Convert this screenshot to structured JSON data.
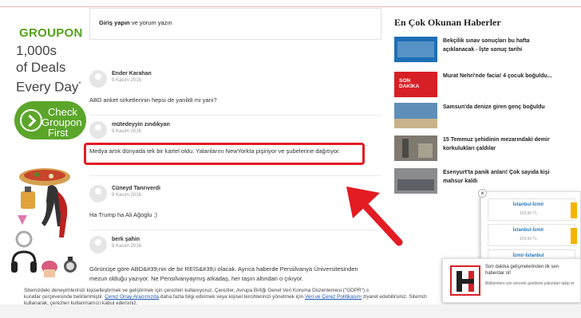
{
  "ad": {
    "logo": "GROUPON",
    "line1": "1,000s",
    "line2": "of Deals",
    "line3": "Every Day",
    "line3_mark": "*",
    "button_line1": "Check",
    "button_line2": "Groupon",
    "button_line3": "First"
  },
  "login": {
    "link": "Giriş yapın",
    "rest": " ve yorum yazın"
  },
  "comments": [
    {
      "name": "Ender Karahan",
      "date": "9 Kasım 2016",
      "text": "ABD anket sirketlerinin hepsi de yanildi mi yani?"
    },
    {
      "name": "mütedeyyin zındıkyan",
      "date": "9 Kasım 2016",
      "text": "Medya artık dünyada tek bir kartel oldu. Yalanlarını NewYorkta pişiriyor ve şubelerine dağıtıyor."
    },
    {
      "name": "Cüneyd Tanrıverdi",
      "date": "9 Kasım 2016",
      "text": "Ha Trump ha Ali Ağoglu :)"
    },
    {
      "name": "berk şahin",
      "date": "9 Kasım 2016",
      "text": "Görünüşe göre ABD&#39;nin de bir REİS&#39;i olacak. Ayrıca haberde Pensilvanya Üniversitesinden",
      "text2": "mezun olduğu yazıyor. Ne Pensilvanyaymış arkadaş, her taşın altından o çıkıyor."
    }
  ],
  "sidebar": {
    "title": "En Çok Okunan Haberler",
    "items": [
      {
        "title": "Bekçilik sınav sonuçları bu hafta açıklanacak - İşte sonuç tarihi",
        "thumb_color": "#1f6fb5"
      },
      {
        "title": "Murat Nehri'nde facia! 4 çocuk boğuldu...",
        "thumb_color": "#d71f26",
        "thumb_text": "SON DAKİKA"
      },
      {
        "title": "Samsun'da denize giren genç boğuldu",
        "thumb_color": "#5f8fb8"
      },
      {
        "title": "15 Temmuz şehidinin mezarındaki demir korkulukları çaldılar",
        "thumb_color": "#7f7a70"
      },
      {
        "title": "Esenyurt'ta panik anları! Çok sayıda kişi mahsur kaldı",
        "thumb_color": "#8a8c8f"
      }
    ]
  },
  "ticket": {
    "routes": [
      {
        "name": "İstanbul-İzmir",
        "price": "109,99 TL"
      },
      {
        "name": "İstanbul-İzmir",
        "price": "109,99 TL"
      },
      {
        "name": "İzmir-İstanbul",
        "price": ""
      }
    ]
  },
  "notification": {
    "title": "Son dakika gelişmelerinden ilk sen haberdar ol!",
    "subtitle": "Bildirimlere izin vererek gündemi yakından takip et"
  },
  "cookie": {
    "line1_a": "Sitemizdeki deneyimlerinizi kişiselleştirmek ve geliştirmek için çerezleri kullanıyoruz. Çerezler, Avrupa Birliği Genel Veri Koruma Düzenlemesi (\"GDPR\") s",
    "line2_a": "kurallar çerçevesinde belirlenmiştir. ",
    "link1": "Çerez Onay Aracımızda",
    "line2_b": " daha fazla bilgi edinmek veya kişisel tercihlerinizi yönetmek için ",
    "link2": "Veri ve Çerez Politikasını",
    "line2_c": " ziyaret edebilirsiniz. Sitemizi",
    "line3": "kullanarak, çerezleri kullanmamızı kabul edersiniz."
  },
  "colors": {
    "groupon_green": "#53a318",
    "highlight_red": "#e31b23",
    "arrow_red": "#e31b23",
    "link_blue": "#2b7bbd"
  }
}
